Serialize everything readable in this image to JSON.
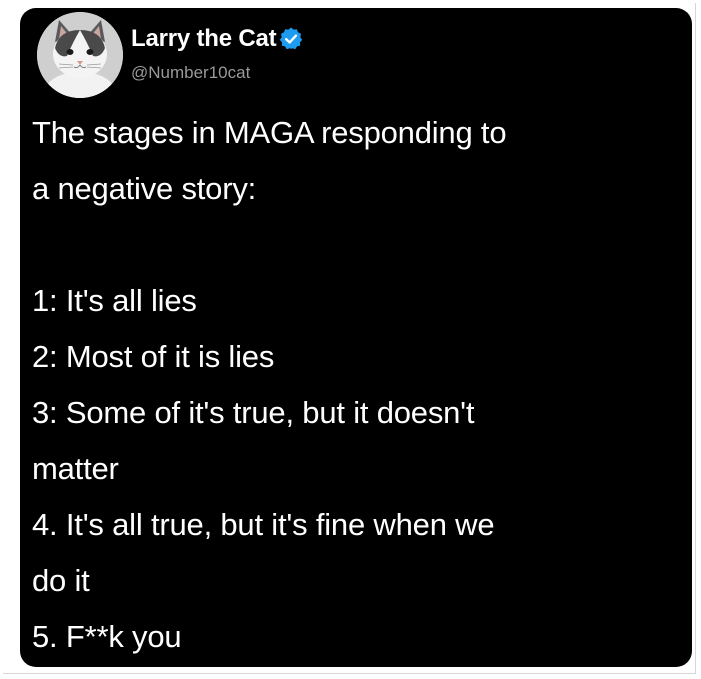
{
  "tweet": {
    "author": {
      "display_name": "Larry the Cat",
      "handle": "@Number10cat",
      "verified_icon": "verified-badge-icon",
      "avatar_icon": "cat-avatar-icon"
    },
    "text": "The stages in MAGA responding to\na negative story:\n\n1: It's all lies\n2: Most of it is lies\n3: Some of it's true, but it doesn't\nmatter\n4. It's all true, but it's fine when we\ndo it\n5. F**k you"
  },
  "colors": {
    "card_background": "#000000",
    "text": "#ffffff",
    "handle": "#9a9a9a",
    "verified": "#1d9bf0"
  }
}
